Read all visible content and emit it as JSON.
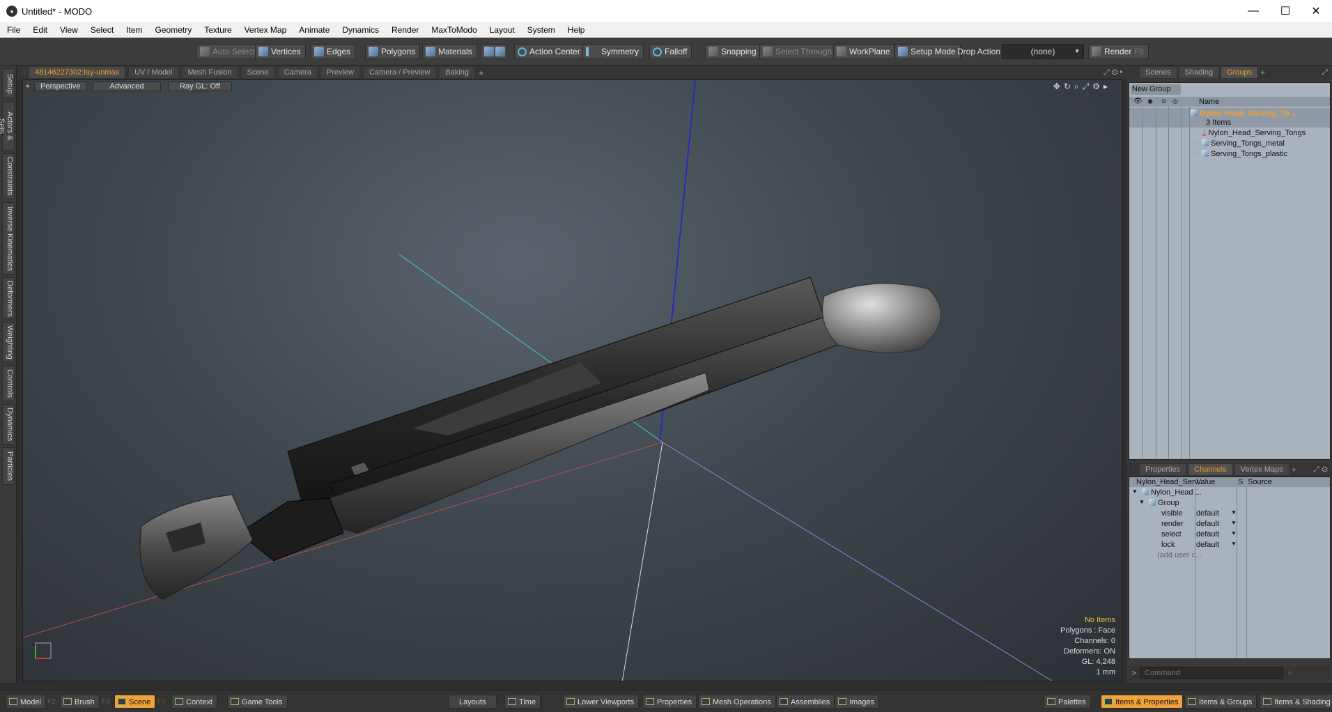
{
  "window": {
    "title": "Untitled* - MODO",
    "minimize": "—",
    "maximize": "☐",
    "close": "✕"
  },
  "menu": [
    "File",
    "Edit",
    "View",
    "Select",
    "Item",
    "Geometry",
    "Texture",
    "Vertex Map",
    "Animate",
    "Dynamics",
    "Render",
    "MaxToModo",
    "Layout",
    "System",
    "Help"
  ],
  "toolbar": {
    "auto_select": "Auto Select",
    "vertices": "Vertices",
    "edges": "Edges",
    "polygons": "Polygons",
    "materials": "Materials",
    "action_center": "Action Center",
    "symmetry": "Symmetry",
    "falloff": "Falloff",
    "snapping": "Snapping",
    "select_through": "Select Through",
    "workplane": "WorkPlane",
    "setup_mode": "Setup Mode",
    "drop_action_label": "Drop Action",
    "drop_action_value": "(none)",
    "render": "Render",
    "render_key": "F9"
  },
  "left_tabs": [
    "Setup",
    "Actors & Sets",
    "Constraints",
    "Inverse Kinematics",
    "Deformers",
    "Weighting",
    "Controls",
    "Dynamics",
    "Particles"
  ],
  "viewport_tabs": [
    "48146227302:lay-unmax",
    "UV / Model",
    "Mesh Fusion",
    "Scene",
    "Camera",
    "Preview",
    "Camera / Preview",
    "Baking",
    "+"
  ],
  "viewport": {
    "view_mode": "Perspective",
    "shading": "Advanced",
    "raygl": "Ray GL: Off",
    "info": {
      "items": "No Items",
      "polygons": "Polygons : Face",
      "channels": "Channels: 0",
      "deformers": "Deformers: ON",
      "gl": "GL: 4,248",
      "unit": "1 mm"
    }
  },
  "scene_tabs": [
    "Scenes",
    "Shading",
    "Groups",
    "+"
  ],
  "groups": {
    "new_group": "New Group",
    "name_header": "Name",
    "root": "Nylon_Head_Serving_To ...",
    "count": "3 Items",
    "children": [
      "Nylon_Head_Serving_Tongs",
      "Serving_Tongs_metal",
      "Serving_Tongs_plastic"
    ]
  },
  "prop_tabs": [
    "Properties",
    "Channels",
    "Vertex Maps",
    "+"
  ],
  "channels": {
    "headers": [
      "Nylon_Head_Serv...",
      "Value",
      "S",
      "Source"
    ],
    "item": "Nylon_Head ...",
    "group": "Group",
    "rows": [
      {
        "name": "visible",
        "value": "default"
      },
      {
        "name": "render",
        "value": "default"
      },
      {
        "name": "select",
        "value": "default"
      },
      {
        "name": "lock",
        "value": "default"
      }
    ],
    "add_user": "(add user c..."
  },
  "command": {
    "prompt": ">",
    "placeholder": "Command"
  },
  "bottom": {
    "model": "Model",
    "model_key": "F2",
    "brush": "Brush",
    "brush_key": "F3",
    "scene": "Scene",
    "scene_key": "F4",
    "context": "Context",
    "game_tools": "Game Tools",
    "layouts": "Layouts",
    "time": "Time",
    "lower_viewports": "Lower Viewports",
    "properties": "Properties",
    "mesh_operations": "Mesh Operations",
    "assemblies": "Assemblies",
    "images": "Images",
    "palettes": "Palettes",
    "items_properties": "Items & Properties",
    "items_groups": "Items & Groups",
    "items_shading": "Items & Shading"
  }
}
